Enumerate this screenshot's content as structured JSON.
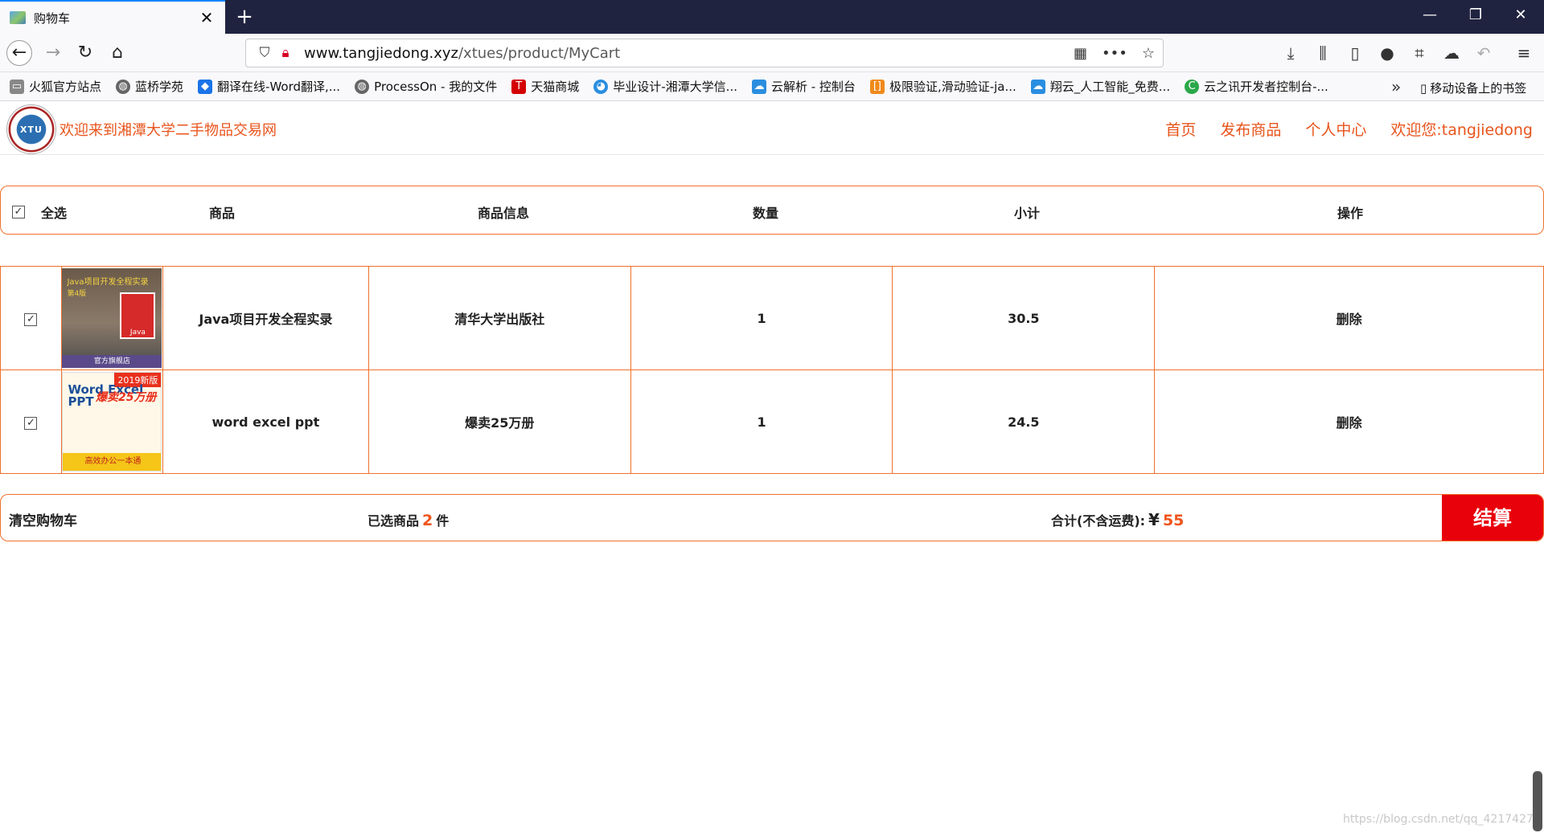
{
  "browser": {
    "tab_title": "购物车",
    "new_tab": "+",
    "window_buttons": [
      "—",
      "❐",
      "✕"
    ],
    "url_domain": "www.tangjiedong.xyz",
    "url_path": "/xtues/product/MyCart",
    "bookmarks": [
      {
        "label": "火狐官方站点",
        "icon": "folder-icon",
        "color": "#777777"
      },
      {
        "label": "蓝桥学苑",
        "icon": "globe-icon",
        "color": "#555555"
      },
      {
        "label": "翻译在线-Word翻译,...",
        "icon": "translate-icon",
        "color": "#1a73e8"
      },
      {
        "label": "ProcessOn - 我的文件",
        "icon": "globe-icon",
        "color": "#555555"
      },
      {
        "label": "天猫商城",
        "icon": "tmall-icon",
        "color": "#d40000"
      },
      {
        "label": "毕业设计-湘潭大学信...",
        "icon": "edu-icon",
        "color": "#2a8ee0"
      },
      {
        "label": "云解析 - 控制台",
        "icon": "cloud-icon",
        "color": "#2a8ee0"
      },
      {
        "label": "极限验证,滑动验证-ja...",
        "icon": "bracket-icon",
        "color": "#f08a1c"
      },
      {
        "label": "翔云_人工智能_免费...",
        "icon": "cloud-icon",
        "color": "#2a8ee0"
      },
      {
        "label": "云之讯开发者控制台-...",
        "icon": "c-icon",
        "color": "#2ba84a"
      }
    ],
    "bookmarks_mobile": "移动设备上的书签"
  },
  "site": {
    "title": "欢迎来到湘潭大学二手物品交易网",
    "logo_text": "XTU",
    "nav": [
      "首页",
      "发布商品",
      "个人中心",
      "欢迎您:tangjiedong"
    ]
  },
  "cart": {
    "headers": {
      "select_all": "全选",
      "product": "商品",
      "info": "商品信息",
      "quantity": "数量",
      "subtotal": "小计",
      "action": "操作"
    },
    "items": [
      {
        "name": "Java项目开发全程实录",
        "info": "清华大学出版社",
        "quantity": "1",
        "subtotal": "30.5",
        "action": "删除",
        "cover": {
          "line1": "Java项目开发全程实录",
          "line2": "第4版",
          "badge": "Java",
          "footer": "官方旗舰店"
        }
      },
      {
        "name": "word excel ppt",
        "info": "爆卖25万册",
        "quantity": "1",
        "subtotal": "24.5",
        "action": "删除",
        "cover": {
          "corner": "2019新版",
          "title": "Word Excel PPT",
          "sale": "爆卖25万册",
          "footer": "高效办公一本通"
        }
      }
    ],
    "footer": {
      "clear": "清空购物车",
      "selected_prefix": "已选商品",
      "selected_count": "2",
      "selected_suffix": "件",
      "total_label": "合计(不含运费):",
      "currency": "¥",
      "total": "55",
      "checkout": "结算"
    }
  },
  "watermark": "https://blog.csdn.net/qq_4217427"
}
